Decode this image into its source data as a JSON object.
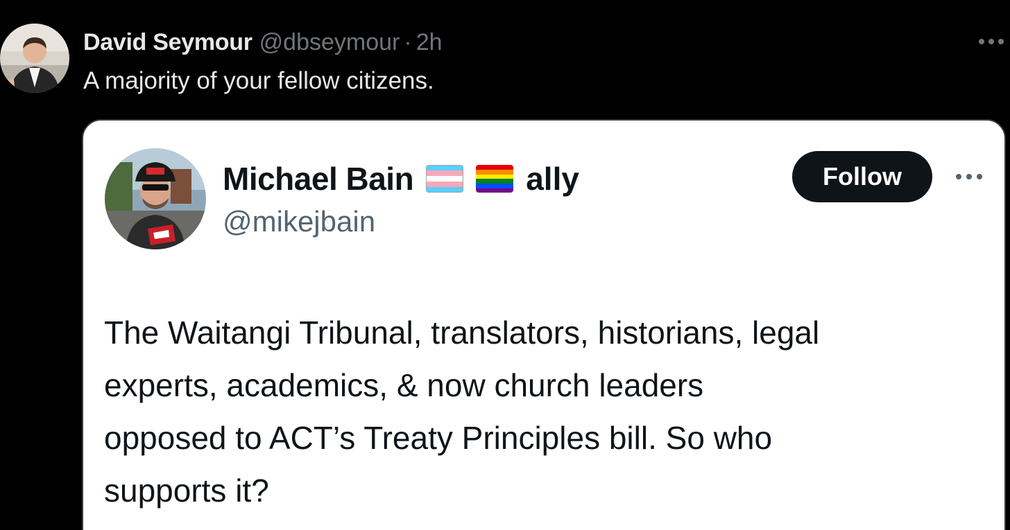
{
  "tweet": {
    "author_name": "David Seymour",
    "handle": "@dbseymour",
    "separator": "·",
    "time": "2h",
    "text": "A majority of your fellow citizens.",
    "avatar_icon": "profile-photo",
    "more_icon": "more-horizontal-icon"
  },
  "quoted_tweet": {
    "author_name": "Michael Bain",
    "flags": [
      "transgender-flag-emoji",
      "rainbow-flag-emoji"
    ],
    "name_suffix": "ally",
    "handle": "@mikejbain",
    "follow_label": "Follow",
    "more_icon": "more-horizontal-icon",
    "text_lines": [
      "The Waitangi Tribunal, translators, historians, legal",
      "experts, academics, & now church leaders",
      "opposed to ACT’s Treaty Principles bill. So who",
      "supports it?"
    ]
  },
  "colors": {
    "background": "#000000",
    "primary_text_dark": "#e7e9ea",
    "secondary_text_dark": "#71767b",
    "card_background": "#ffffff",
    "primary_text_light": "#0f1419",
    "secondary_text_light": "#536471",
    "follow_button": "#0f1419"
  }
}
